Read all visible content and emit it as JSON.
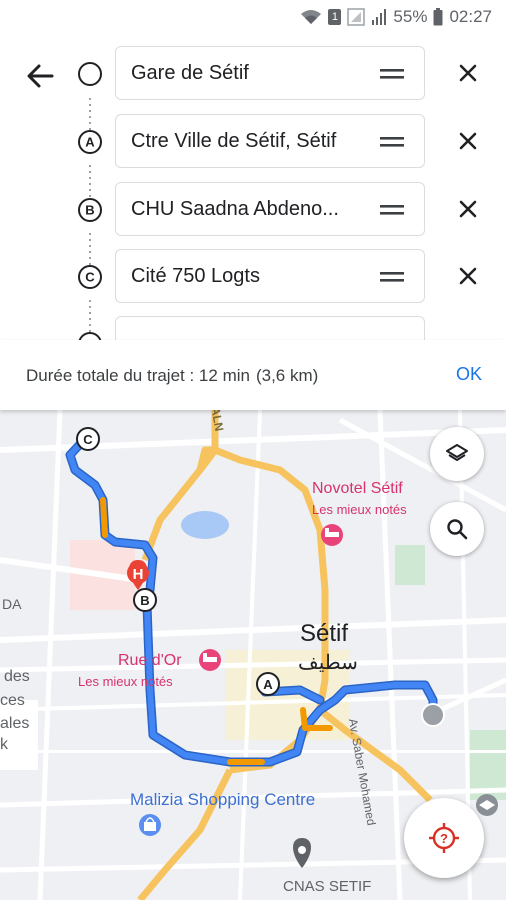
{
  "status_bar": {
    "battery_percent": "55%",
    "time": "02:27",
    "sim_slot": "1"
  },
  "trip": {
    "stops": [
      {
        "marker": "",
        "label": "Gare de Sétif"
      },
      {
        "marker": "A",
        "label": "Ctre Ville de Sétif, Sétif"
      },
      {
        "marker": "B",
        "label": "CHU Saadna Abdeno..."
      },
      {
        "marker": "C",
        "label": "Cité 750 Logts"
      }
    ]
  },
  "summary": {
    "duration_text": "Durée totale du trajet : 12 min",
    "distance_text": "(3,6 km)",
    "ok_label": "OK"
  },
  "map": {
    "places": {
      "novotel_name": "Novotel Sétif",
      "novotel_sub": "Les mieux notés",
      "rue_dor_name": "Rue d'Or",
      "rue_dor_sub": "Les mieux notés",
      "city_name": "Sétif",
      "city_name_ar": "سطيف",
      "mall_name": "Malizia Shopping Centre",
      "cnas_name": "CNAS SETIF",
      "street_name": "Av. Saber Mohamed",
      "road_label": "ALN",
      "edge_label_1": "DA",
      "edge_label_2": "des",
      "edge_label_3": "ces",
      "edge_label_4": "ales",
      "edge_label_5": "k"
    },
    "route_markers": {
      "a": "A",
      "b": "B",
      "c": "C"
    },
    "colors": {
      "route": "#4285f4",
      "route_traffic": "#f29900",
      "highway": "#f7c35f",
      "hotel_pin": "#e8447a",
      "hospital_pin": "#ea4335",
      "mall_pin": "#5a8ef0",
      "accent": "#1a73e8"
    },
    "icons": [
      "layers-icon",
      "search-icon",
      "locate-me-icon"
    ]
  }
}
